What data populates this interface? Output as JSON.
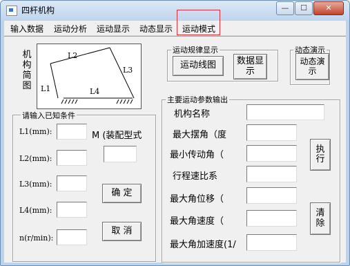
{
  "window": {
    "title": "四杆机构",
    "min_icon": "minimize-icon",
    "max_icon": "maximize-icon",
    "close_icon": "close-icon"
  },
  "menu": [
    "输入数据",
    "运动分析",
    "运动显示",
    "动态显示",
    "运动模式"
  ],
  "diagram": {
    "side_label": "机构简图",
    "labels": [
      "L1",
      "L2",
      "L3",
      "L4"
    ]
  },
  "motion_group": {
    "title": "运动规律显示",
    "motion_curve_button": "运动线图",
    "data_display_button": "数据显示"
  },
  "dynamic_group": {
    "title": "动态演示",
    "button": "动态演示"
  },
  "input_group": {
    "title": "请输入已知条件",
    "labels": [
      "L1(mm):",
      "L2(mm):",
      "L3(mm):",
      "L4(mm):",
      "n(r/min):"
    ],
    "values": [
      "",
      "",
      "",
      "",
      ""
    ],
    "m_label": "M (装配型式",
    "m_value": "",
    "confirm_button": "确 定",
    "cancel_button": "取 消"
  },
  "output_group": {
    "title": "主要运动参数输出",
    "labels": [
      "机构名称",
      "最大摆角（度",
      "最小传动角（",
      "行程速比系",
      "最大角位移（",
      "最大角速度（",
      "最大角加速度(1/"
    ],
    "values": [
      "",
      "",
      "",
      "",
      "",
      "",
      ""
    ],
    "execute_button": "执行",
    "clear_button": "清除"
  },
  "colors": {
    "window_frame": "#bcd3ec",
    "face": "#f0f0f0",
    "highlight": "#e0303a"
  }
}
